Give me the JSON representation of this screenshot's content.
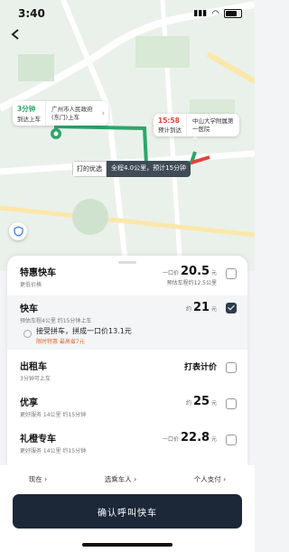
{
  "status": {
    "time": "3:40"
  },
  "map": {
    "origin": {
      "eta": "3分钟",
      "eta_sub": "到达上车",
      "name": "广州市人民政府",
      "name_sub": "(东门)上车"
    },
    "dest": {
      "time": "15:58",
      "time_sub": "预计到达",
      "name": "中山大学附属第",
      "name_sub": "一医院"
    },
    "route": {
      "tag": "打的优选",
      "info": "全程4.0公里，预计15分钟"
    },
    "labels": [
      "广州市人民政府",
      "中山大学附属第一医院"
    ]
  },
  "options": [
    {
      "title": "特惠快车",
      "sub": "更低价格",
      "price_prefix": "一口价",
      "price": "20.5",
      "unit": "元",
      "price_sub": "预估车程约12.5公里",
      "checked": false
    },
    {
      "title": "快车",
      "sub": "预估车程4公里 约15分钟上车",
      "price_prefix": "约",
      "price": "21",
      "unit": "元",
      "price_sub": "",
      "checked": true
    },
    {
      "title": "出租车",
      "sub": "3分钟可上车",
      "price_prefix": "",
      "price": "打表计价",
      "unit": "",
      "price_sub": "",
      "checked": false
    },
    {
      "title": "优享",
      "sub": "更好服务 14公里 约15分钟",
      "price_prefix": "约",
      "price": "25",
      "unit": "元",
      "price_sub": "",
      "checked": false
    },
    {
      "title": "礼橙专车",
      "sub": "更好服务 14公里 约15分钟",
      "price_prefix": "一口价",
      "price": "22.8",
      "unit": "元",
      "price_sub": "",
      "checked": false
    }
  ],
  "carpool": {
    "label": "接受拼车，拼成一口价13.1元",
    "sub": "限时特惠 最高省7元"
  },
  "bottom": {
    "options": [
      "现在 ›",
      "选乘车人 ›",
      "个人支付 ›"
    ],
    "cta": "确认呼叫快车"
  }
}
